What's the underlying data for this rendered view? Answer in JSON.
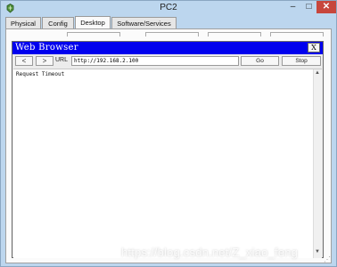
{
  "window": {
    "title": "PC2",
    "minimize_glyph": "–",
    "maximize_glyph": "□",
    "close_glyph": "✕",
    "icon": "pc-icon"
  },
  "tabs": [
    {
      "label": "Physical",
      "active": false
    },
    {
      "label": "Config",
      "active": false
    },
    {
      "label": "Desktop",
      "active": true
    },
    {
      "label": "Software/Services",
      "active": false
    }
  ],
  "browser": {
    "title": "Web Browser",
    "close_label": "X",
    "back_label": "<",
    "forward_label": ">",
    "url_label": "URL",
    "url_value": "http://192.168.2.100",
    "go_label": "Go",
    "stop_label": "Stop",
    "content": "Request Timeout",
    "title_color": "#0000ee"
  },
  "watermark": "https://blog.csdn.net/Z_xiao_feng"
}
